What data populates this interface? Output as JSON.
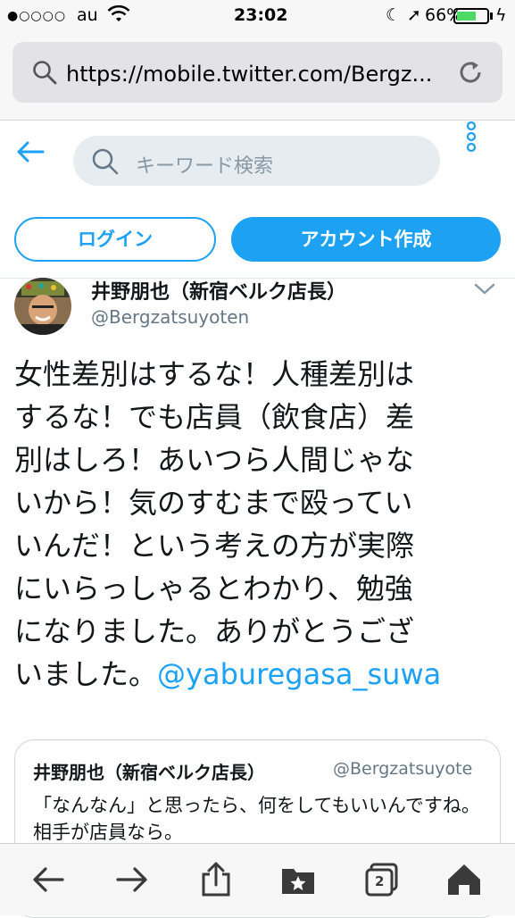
{
  "status_bar": {
    "signal": "●○○○○",
    "carrier": "au",
    "time": "23:02",
    "battery_percent": "66%",
    "battery_level": 0.66
  },
  "browser": {
    "url": "https://mobile.twitter.com/Bergz..."
  },
  "header": {
    "search_placeholder": "キーワード検索"
  },
  "auth": {
    "login_label": "ログイン",
    "signup_label": "アカウント作成"
  },
  "tweet": {
    "author_name": "井野朋也（新宿ベルク店長）",
    "author_handle": "@Bergzatsuyoten",
    "lines": [
      "女性差別はするな！人種差別は",
      "するな！でも店員（飲食店）差",
      "別はしろ！あいつら人間じゃな",
      "いから！気のすむまで殴ってい",
      "いんだ！という考えの方が実際",
      "にいらっしゃるとわかり、勉強",
      "になりました。ありがとうござ"
    ],
    "last_line_text": "いました。",
    "mention": "@yaburegasa_suwa"
  },
  "quote": {
    "author_name": "井野朋也（新宿ベルク店長）",
    "author_handle": "@Bergzatsuyote",
    "text": "「なんなん」と思ったら、何をしてもいいんですね。相手が店員なら。"
  },
  "toolbar": {
    "tab_count": "2"
  },
  "colors": {
    "accent": "#1da1f2",
    "battery": "#4cd964"
  }
}
